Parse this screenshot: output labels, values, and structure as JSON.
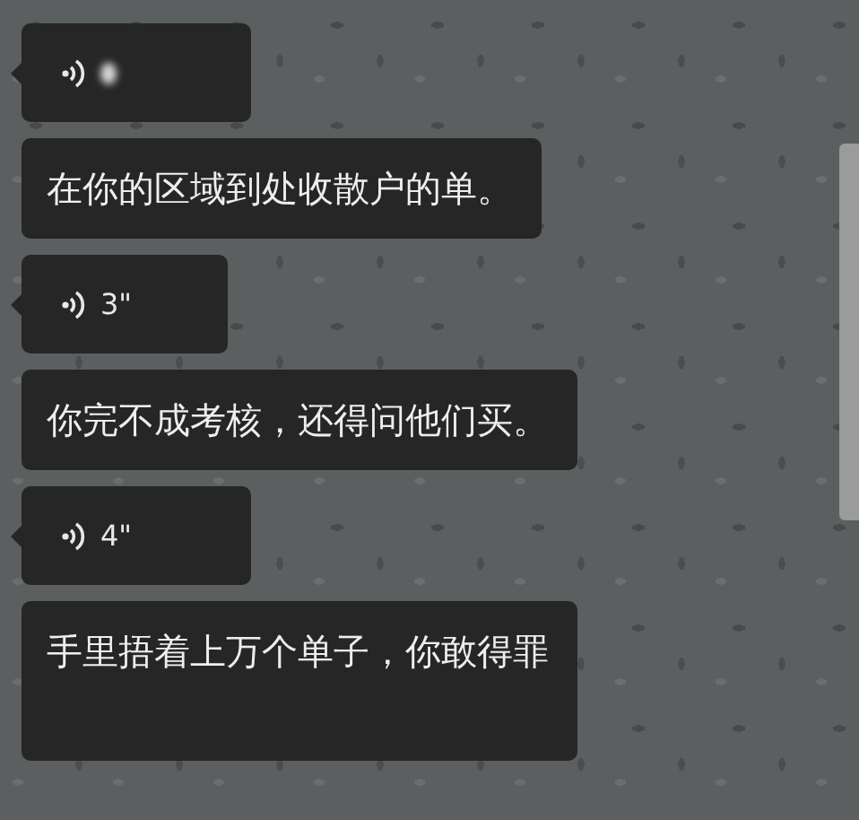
{
  "messages": [
    {
      "kind": "voice",
      "redacted": true
    },
    {
      "kind": "text",
      "text": "在你的区域到处收散户的单。"
    },
    {
      "kind": "voice",
      "duration": "3\""
    },
    {
      "kind": "text",
      "text": "你完不成考核，还得问他们买。"
    },
    {
      "kind": "voice",
      "duration": "4\""
    },
    {
      "kind": "text",
      "text": "手里捂着上万个单子，你敢得罪",
      "cut": true
    }
  ]
}
